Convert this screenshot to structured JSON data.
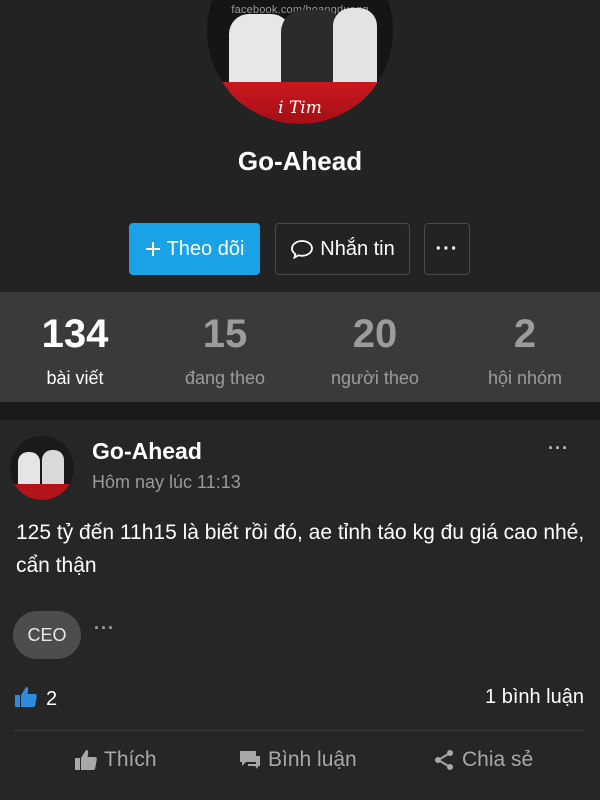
{
  "profile": {
    "avatar_watermark": "facebook.com/hoangduong",
    "avatar_signature": "i Tim",
    "name": "Go-Ahead",
    "follow_label": "Theo dõi",
    "message_label": "Nhắn tin",
    "more_label": "···"
  },
  "stats": [
    {
      "value": "134",
      "label": "bài viết"
    },
    {
      "value": "15",
      "label": "đang theo"
    },
    {
      "value": "20",
      "label": "người theo"
    },
    {
      "value": "2",
      "label": "hội nhóm"
    }
  ],
  "post": {
    "author": "Go-Ahead",
    "time": "Hôm nay lúc 11:13",
    "menu": "···",
    "text": "125 tỷ đến 11h15 là biết rồi đó, ae tỉnh táo kg đu giá cao nhé, cẩn thận",
    "badge": "CEO",
    "badge_more": "···",
    "like_count": "2",
    "comment_count": "1 bình luận",
    "actions": {
      "like": "Thích",
      "comment": "Bình luận",
      "share": "Chia sẻ"
    }
  },
  "colors": {
    "accent": "#1aa2e6",
    "background": "#232323",
    "stats_bg": "#3a3a3a",
    "avatar_banner": "#c8181e"
  },
  "icons": {
    "follow": "plus-icon",
    "message": "speech-bubble-icon",
    "like": "thumbs-up-icon",
    "comment": "comment-icon",
    "share": "share-icon"
  }
}
